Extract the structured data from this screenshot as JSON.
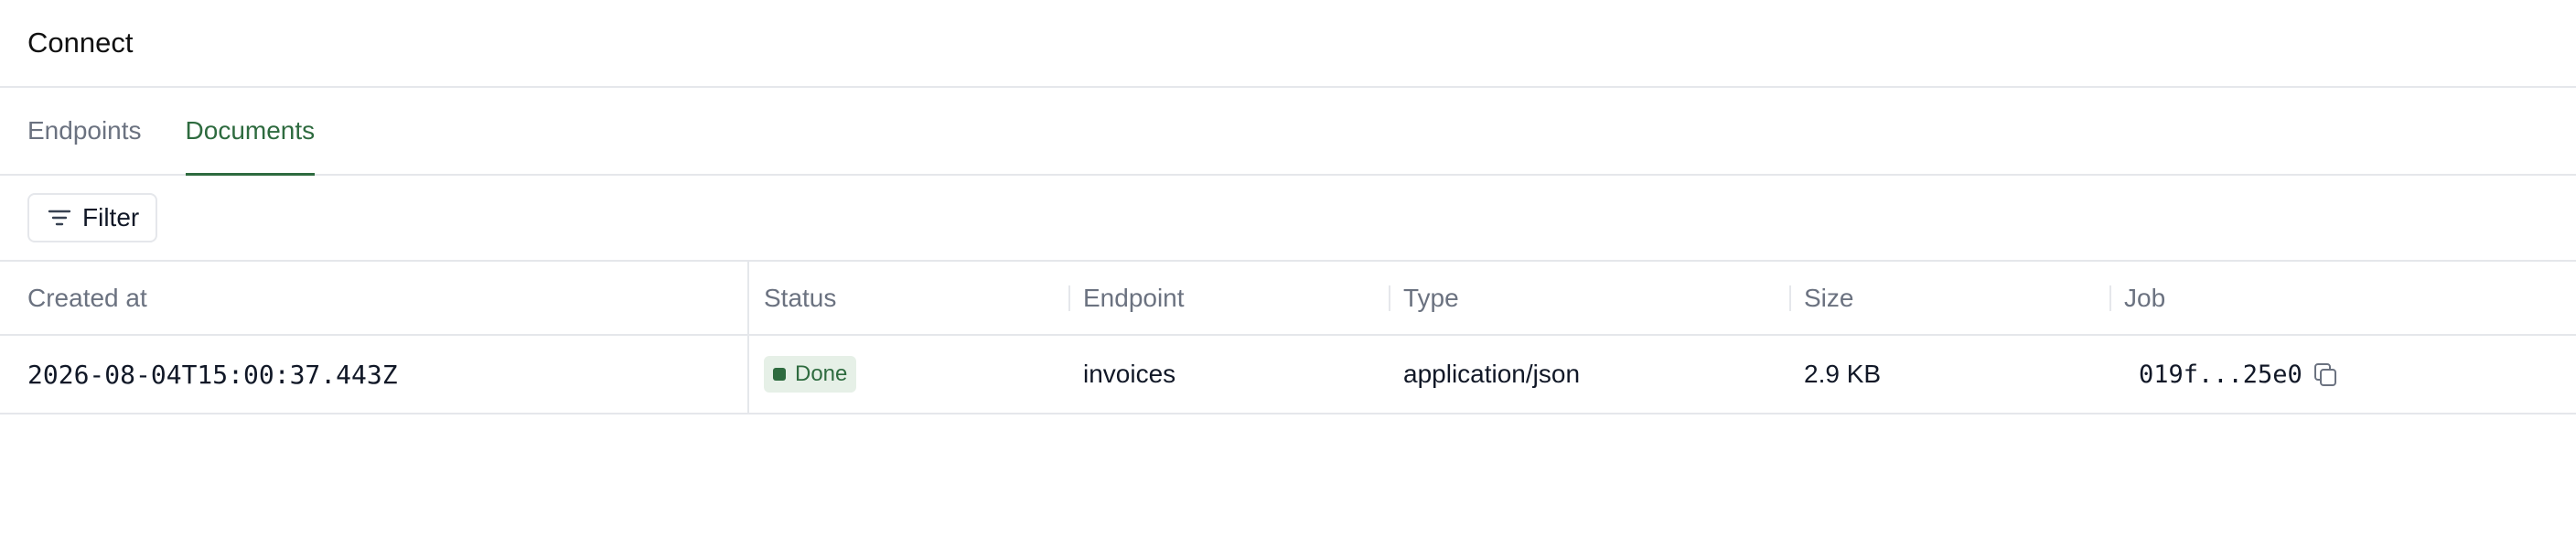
{
  "header": {
    "title": "Connect"
  },
  "tabs": [
    {
      "label": "Endpoints",
      "active": false
    },
    {
      "label": "Documents",
      "active": true
    }
  ],
  "toolbar": {
    "filter_label": "Filter",
    "filter_icon": "filter-lines-icon"
  },
  "table": {
    "columns": [
      "Created at",
      "Status",
      "Endpoint",
      "Type",
      "Size",
      "Job"
    ],
    "rows": [
      {
        "created_at": "2026-08-04T15:00:37.443Z",
        "status": "Done",
        "endpoint": "invoices",
        "type": "application/json",
        "size": "2.9 KB",
        "job": "019f...25e0"
      }
    ]
  },
  "colors": {
    "accent": "#2e6b3f",
    "badge_bg": "#e6f0e7",
    "border": "#e5e7eb",
    "muted_text": "#6b7280"
  }
}
